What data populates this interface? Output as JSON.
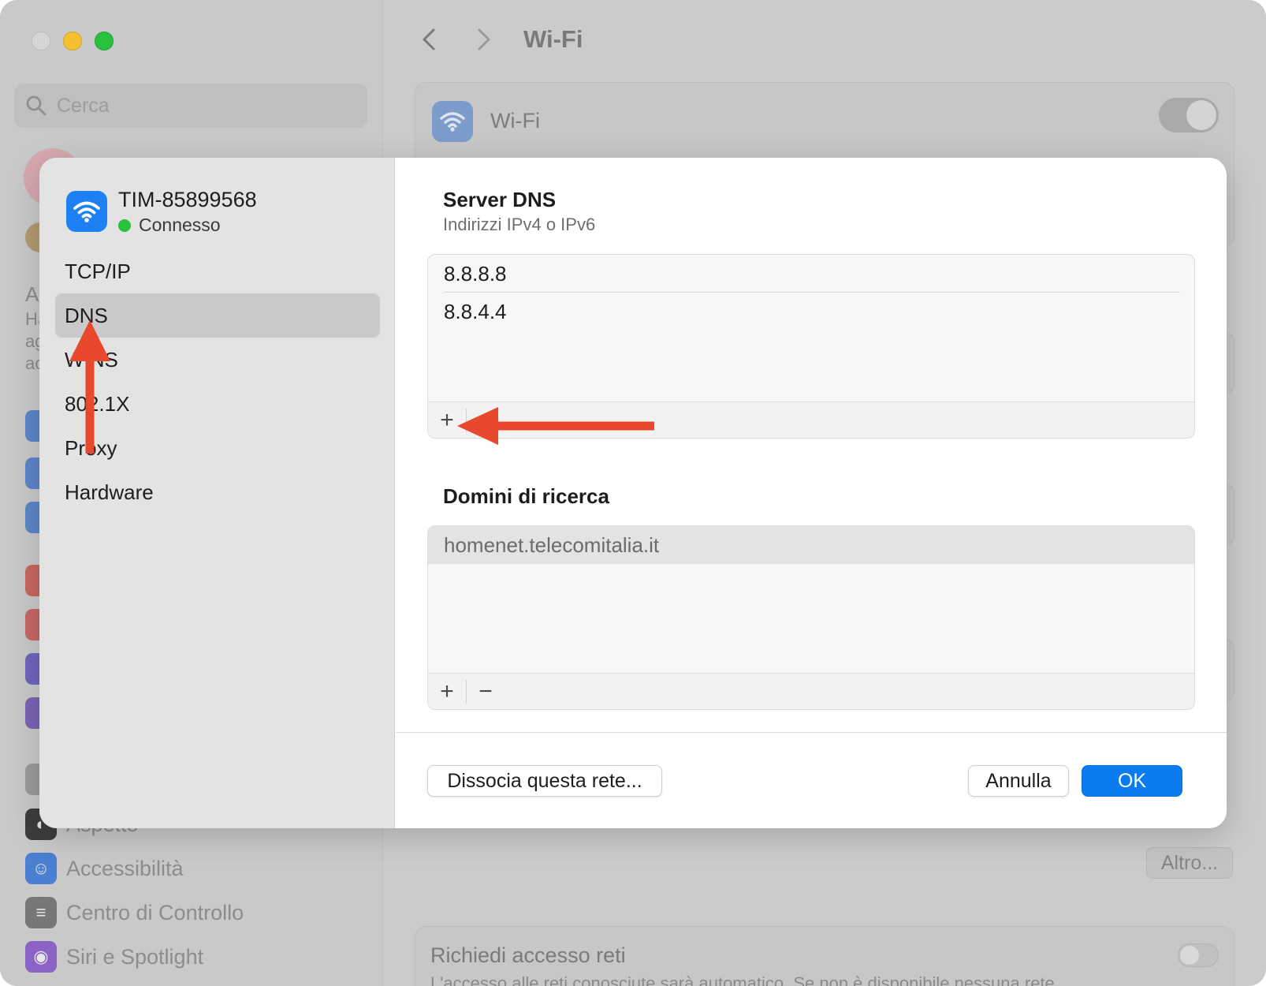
{
  "window": {
    "title": "Wi-Fi",
    "search_placeholder": "Cerca"
  },
  "background_sidebar": {
    "visible_fragment_1": "A",
    "visible_fragment_2": "Ha",
    "visible_fragment_3": "ag",
    "visible_fragment_4": "ac",
    "items": [
      {
        "label": "Aspetto",
        "icon": "appearance-icon",
        "color": "#3d3d3d"
      },
      {
        "label": "Accessibilità",
        "icon": "accessibility-icon",
        "color": "#3b77d6"
      },
      {
        "label": "Centro di Controllo",
        "icon": "control-center-icon",
        "color": "#6d6d6d"
      },
      {
        "label": "Siri e Spotlight",
        "icon": "siri-icon",
        "color": "#7b4fb8"
      }
    ]
  },
  "background_main": {
    "wifi_label": "Wi-Fi",
    "altro_button": "Altro...",
    "request_title": "Richiedi accesso reti",
    "request_subtitle": "L'accesso alle reti conosciute sarà automatico. Se non è disponibile nessuna rete"
  },
  "sheet": {
    "network": {
      "name": "TIM-85899568",
      "status": "Connesso",
      "status_color": "#29c23f"
    },
    "menu": [
      {
        "label": "TCP/IP",
        "active": false
      },
      {
        "label": "DNS",
        "active": true
      },
      {
        "label": "WINS",
        "active": false
      },
      {
        "label": "802.1X",
        "active": false
      },
      {
        "label": "Proxy",
        "active": false
      },
      {
        "label": "Hardware",
        "active": false
      }
    ],
    "dns": {
      "title": "Server DNS",
      "subtitle": "Indirizzi IPv4 o IPv6",
      "servers": [
        "8.8.8.8",
        "8.8.4.4"
      ],
      "add_label": "+"
    },
    "search_domains": {
      "title": "Domini di ricerca",
      "entries": [
        "homenet.telecomitalia.it"
      ],
      "add_label": "+",
      "remove_label": "−"
    },
    "buttons": {
      "forget": "Dissocia questa rete...",
      "cancel": "Annulla",
      "ok": "OK"
    },
    "accent_color": "#0a7cf0"
  },
  "annotations": {
    "arrow_color": "#e8492c"
  }
}
